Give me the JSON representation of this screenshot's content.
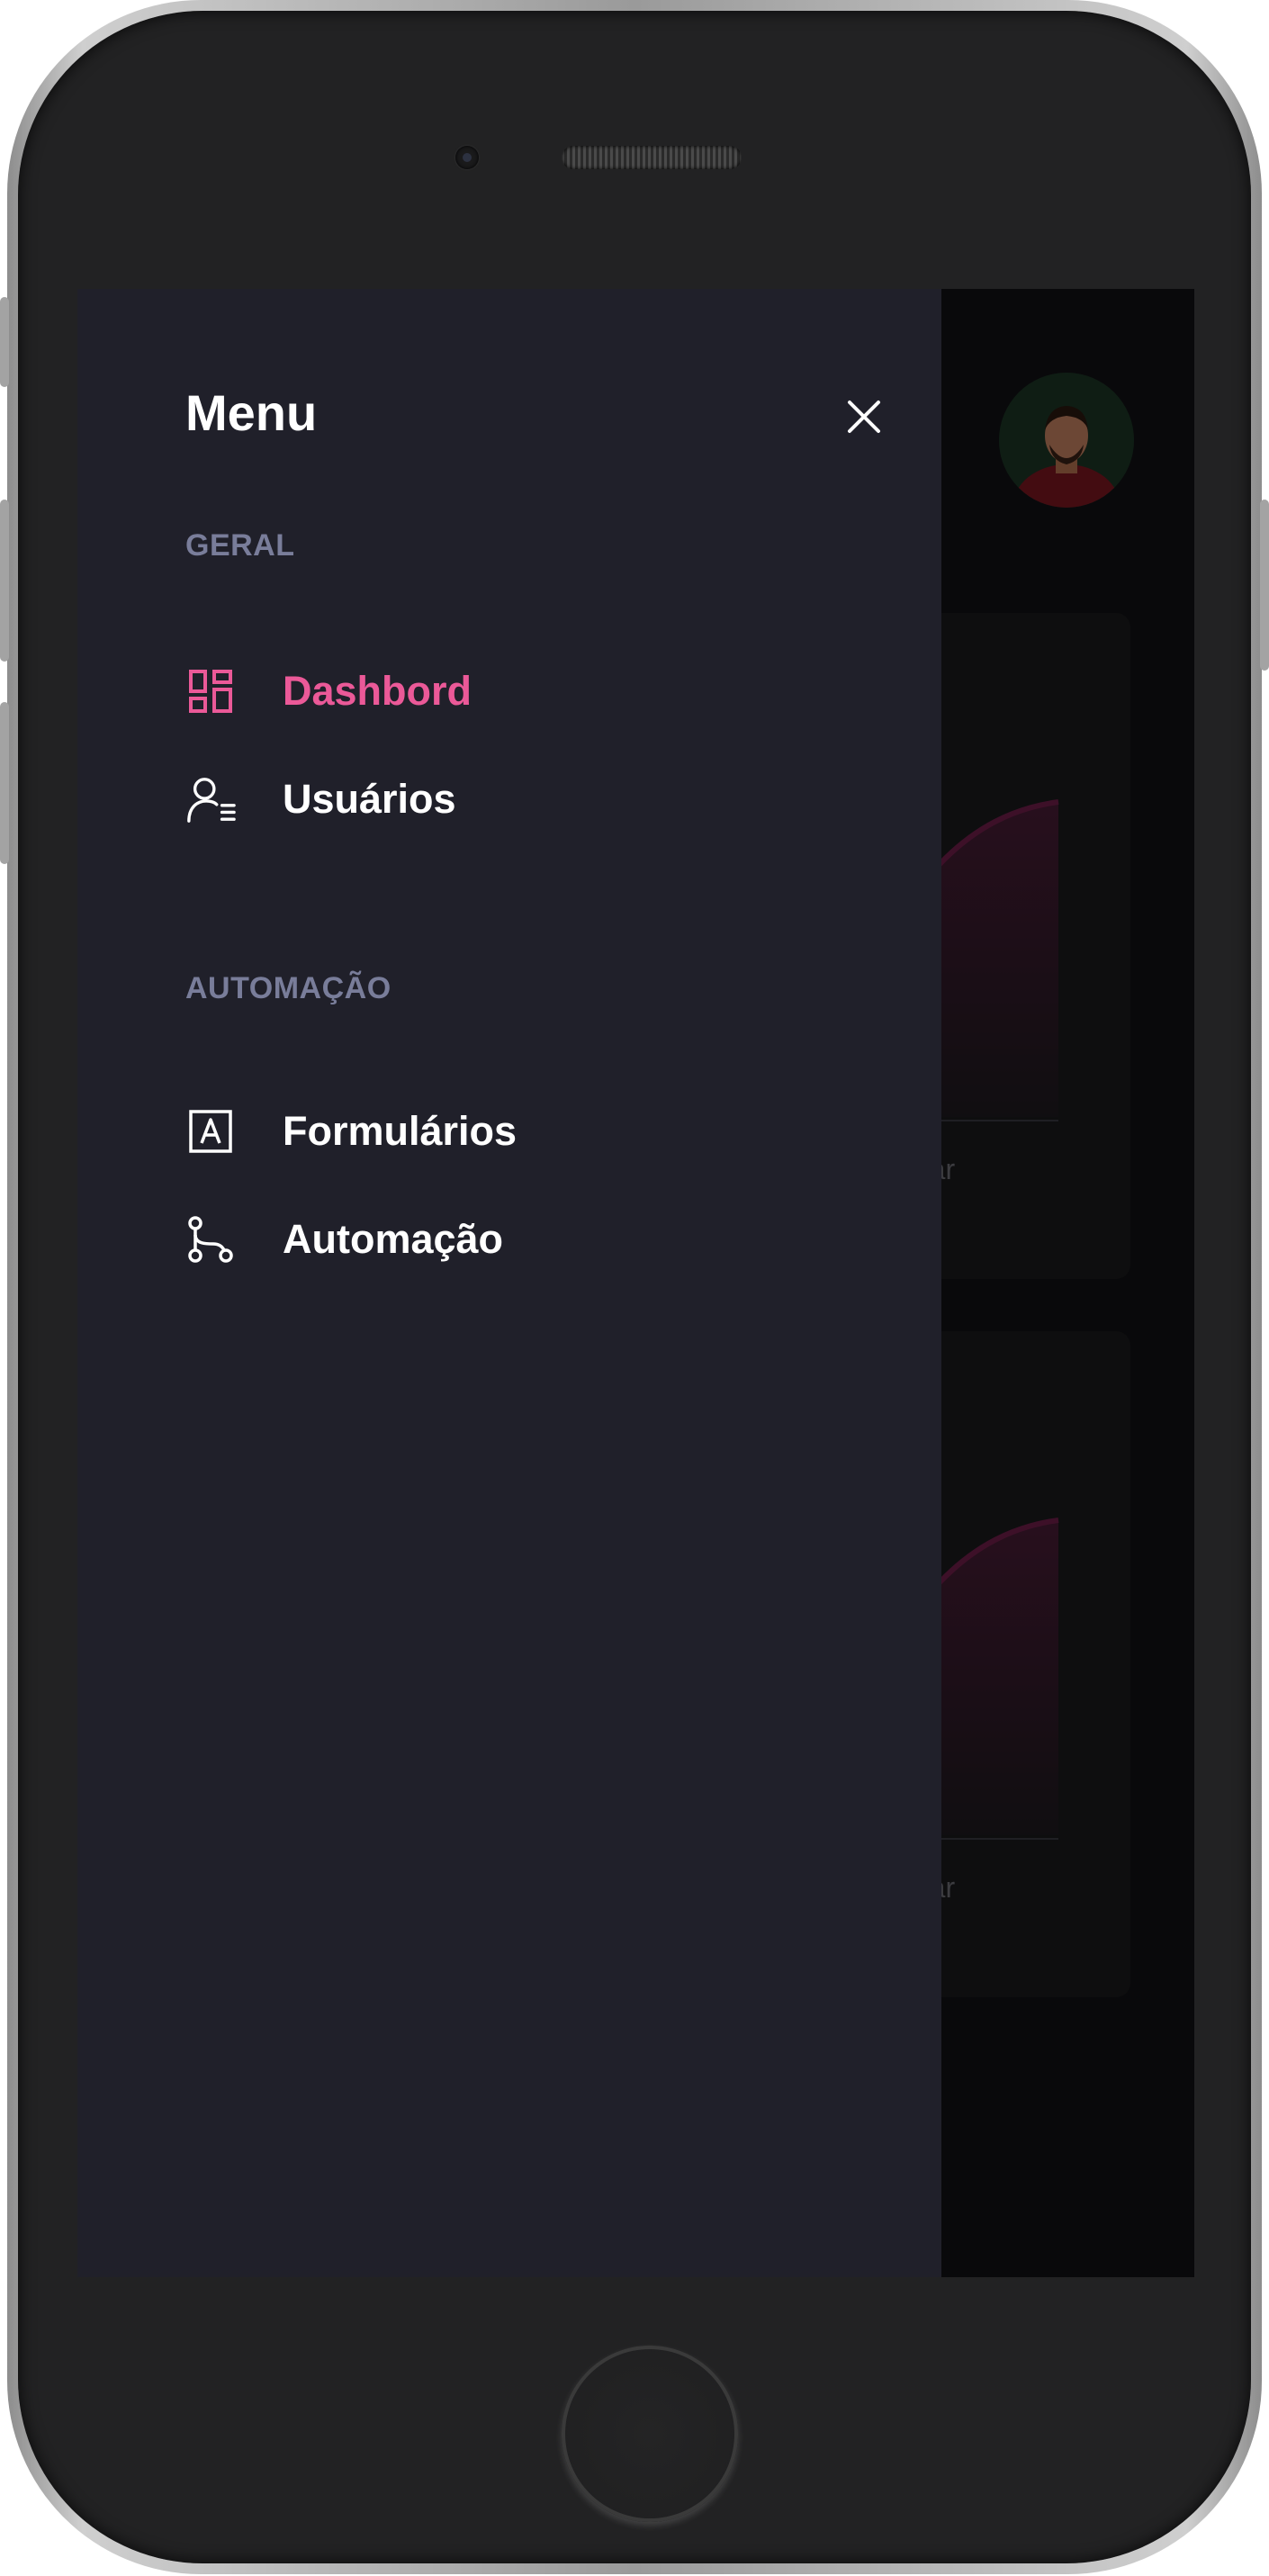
{
  "drawer": {
    "title": "Menu",
    "close_icon": "close-icon",
    "sections": [
      {
        "title": "GERAL",
        "items": [
          {
            "label": "Dashbord",
            "icon": "dashboard-icon",
            "active": true
          },
          {
            "label": "Usuários",
            "icon": "users-icon",
            "active": false
          }
        ]
      },
      {
        "title": "AUTOMAÇÃO",
        "items": [
          {
            "label": "Formulários",
            "icon": "form-icon",
            "active": false
          },
          {
            "label": "Automação",
            "icon": "automation-icon",
            "active": false
          }
        ]
      }
    ]
  },
  "background": {
    "charts": [
      {
        "last_x_label": "Mar"
      },
      {
        "last_x_label": "Mar"
      }
    ]
  },
  "colors": {
    "accent": "#eb5998",
    "drawer_bg": "#20202a",
    "section_title": "#797d9a",
    "chart_line": "#6f1e4a"
  }
}
